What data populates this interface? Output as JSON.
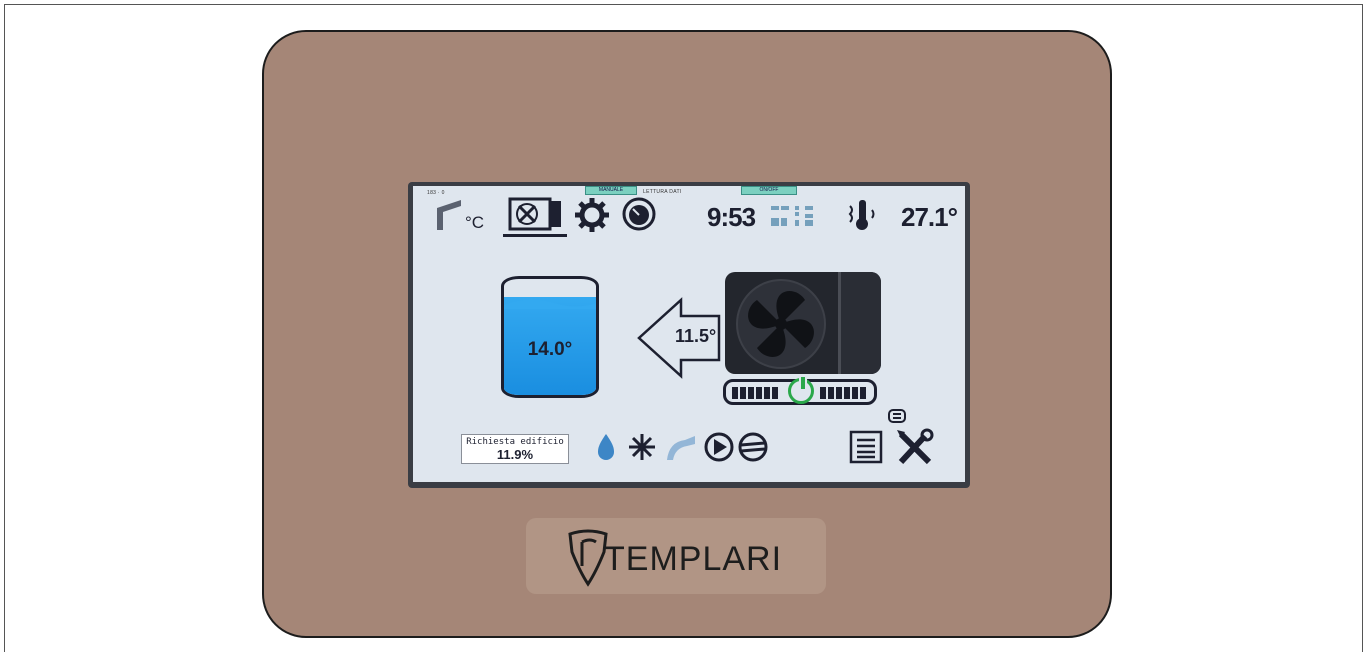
{
  "status_bar": {
    "time": "9:53",
    "outdoor_temp": "27.1°",
    "badge_left": "MANUALE",
    "badge_right": "ON/OFF",
    "label_small": "LETTURA DATI",
    "label_corner": "183 · 0"
  },
  "tank": {
    "temp": "14.0°",
    "water_color": "#1a8ee0"
  },
  "flow": {
    "temp": "11.5°"
  },
  "request": {
    "label": "Richiesta edificio",
    "value": "11.9%"
  },
  "brand": {
    "name": "TEMPLARI"
  },
  "colors": {
    "device": "#a58677",
    "screen": "#dfe6ee",
    "power_on": "#2aa84a",
    "text": "#1d2030"
  },
  "icons": [
    "house-celsius-icon",
    "fan-unit-icon",
    "gear-icon",
    "dial-icon",
    "thermometer-icon",
    "water-drop-icon",
    "snowflake-icon",
    "shower-icon",
    "pump-play-icon",
    "compressor-icon",
    "menu-list-icon",
    "tools-icon",
    "chain-link-icon",
    "power-icon"
  ]
}
